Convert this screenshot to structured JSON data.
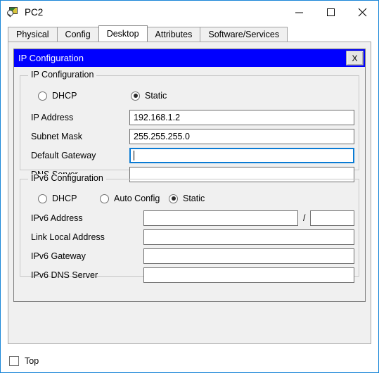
{
  "window": {
    "title": "PC2",
    "icon": "pc-magnifier-icon",
    "controls": {
      "minimize": "minimize-icon",
      "maximize": "maximize-icon",
      "close": "close-icon"
    }
  },
  "tabs": [
    {
      "label": "Physical",
      "active": false
    },
    {
      "label": "Config",
      "active": false
    },
    {
      "label": "Desktop",
      "active": true
    },
    {
      "label": "Attributes",
      "active": false
    },
    {
      "label": "Software/Services",
      "active": false
    }
  ],
  "dialog": {
    "title": "IP Configuration",
    "close_label": "X",
    "ipv4": {
      "legend": "IP Configuration",
      "modes": [
        {
          "label": "DHCP",
          "selected": false
        },
        {
          "label": "Static",
          "selected": true
        }
      ],
      "fields": [
        {
          "label": "IP Address",
          "value": "192.168.1.2",
          "focused": false
        },
        {
          "label": "Subnet Mask",
          "value": "255.255.255.0",
          "focused": false
        },
        {
          "label": "Default Gateway",
          "value": "",
          "focused": true
        },
        {
          "label": "DNS Server",
          "value": "",
          "focused": false
        }
      ]
    },
    "ipv6": {
      "legend": "IPv6 Configuration",
      "modes": [
        {
          "label": "DHCP",
          "selected": false
        },
        {
          "label": "Auto Config",
          "selected": false
        },
        {
          "label": "Static",
          "selected": true
        }
      ],
      "address_label": "IPv6 Address",
      "address_value": "",
      "prefix_separator": "/",
      "prefix_value": "",
      "fields": [
        {
          "label": "Link Local Address",
          "value": ""
        },
        {
          "label": "IPv6 Gateway",
          "value": ""
        },
        {
          "label": "IPv6 DNS Server",
          "value": ""
        }
      ]
    }
  },
  "bottom": {
    "top_checkbox_label": "Top",
    "top_checkbox_checked": false
  },
  "colors": {
    "window_border": "#1a86d8",
    "dialog_titlebar": "#0000ff",
    "focus_border": "#0a7bd4",
    "panel_bg": "#f0f0f0"
  }
}
